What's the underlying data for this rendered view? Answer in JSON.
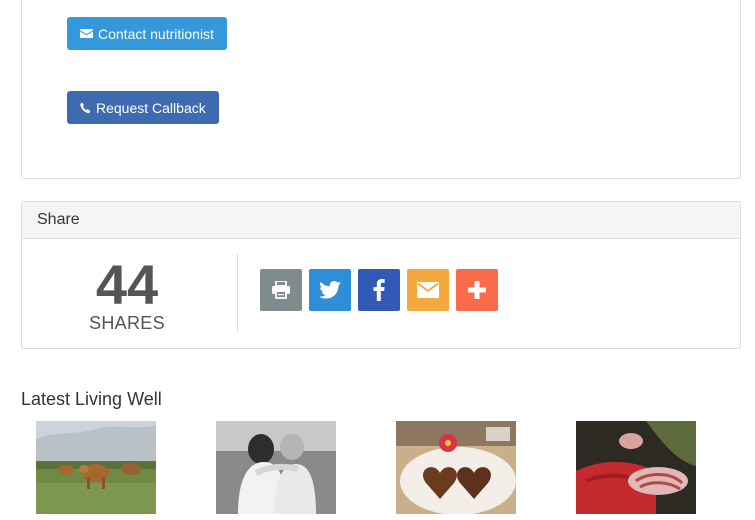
{
  "contact": {
    "nutritionist_label": "Contact nutritionist",
    "callback_label": "Request Callback",
    "nutritionist_color": "#3498db",
    "callback_color": "#3e6bb0"
  },
  "share": {
    "heading": "Share",
    "count": "44",
    "count_label": "SHARES",
    "buttons": [
      {
        "name": "print",
        "icon": "print-icon",
        "color": "#7f8c8d"
      },
      {
        "name": "twitter",
        "icon": "twitter-icon",
        "color": "#2e8ed8"
      },
      {
        "name": "facebook",
        "icon": "facebook-icon",
        "color": "#3159b5"
      },
      {
        "name": "email",
        "icon": "email-icon",
        "color": "#f4a83e"
      },
      {
        "name": "more",
        "icon": "plus-icon",
        "color": "#f86a4a"
      }
    ]
  },
  "latest": {
    "title": "Latest Living Well",
    "thumbnails": [
      {
        "subject": "highland-cattle-photo"
      },
      {
        "subject": "two-women-embracing-photo"
      },
      {
        "subject": "heart-shaped-cakes-photo"
      },
      {
        "subject": "red-sweater-hat-photo"
      }
    ]
  }
}
